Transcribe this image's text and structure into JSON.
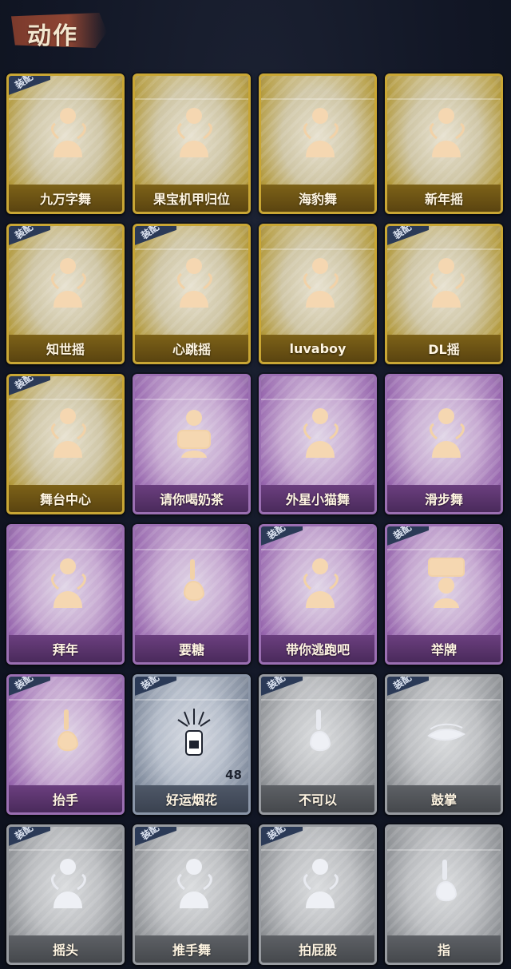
{
  "header": {
    "title": "动作"
  },
  "badges": {
    "equip": "装配"
  },
  "cards": [
    {
      "label": "九万字舞",
      "tier": "gold",
      "equipped": true,
      "icon": "dance-icon"
    },
    {
      "label": "果宝机甲归位",
      "tier": "gold",
      "equipped": false,
      "icon": "dance-icon"
    },
    {
      "label": "海豹舞",
      "tier": "gold",
      "equipped": false,
      "icon": "dance-icon"
    },
    {
      "label": "新年摇",
      "tier": "gold",
      "equipped": false,
      "icon": "dance-icon"
    },
    {
      "label": "知世摇",
      "tier": "gold",
      "equipped": true,
      "icon": "dance-icon"
    },
    {
      "label": "心跳摇",
      "tier": "gold",
      "equipped": true,
      "icon": "dance-icon"
    },
    {
      "label": "luvaboy",
      "tier": "gold",
      "equipped": false,
      "icon": "dance-icon"
    },
    {
      "label": "DL摇",
      "tier": "gold",
      "equipped": true,
      "icon": "dance-icon"
    },
    {
      "label": "舞台中心",
      "tier": "gold",
      "equipped": true,
      "icon": "dance-icon"
    },
    {
      "label": "请你喝奶茶",
      "tier": "purple",
      "equipped": false,
      "icon": "tea-icon"
    },
    {
      "label": "外星小猫舞",
      "tier": "purple",
      "equipped": false,
      "icon": "dance-icon"
    },
    {
      "label": "滑步舞",
      "tier": "purple",
      "equipped": false,
      "icon": "dance-icon"
    },
    {
      "label": "拜年",
      "tier": "purple",
      "equipped": false,
      "icon": "greeting-icon"
    },
    {
      "label": "要糖",
      "tier": "purple",
      "equipped": false,
      "icon": "hand-icon"
    },
    {
      "label": "带你逃跑吧",
      "tier": "purple",
      "equipped": true,
      "icon": "dance-icon"
    },
    {
      "label": "举牌",
      "tier": "purple",
      "equipped": true,
      "icon": "sign-icon"
    },
    {
      "label": "抬手",
      "tier": "purple",
      "equipped": true,
      "icon": "hand-icon"
    },
    {
      "label": "好运烟花",
      "tier": "blue",
      "equipped": true,
      "icon": "firework-icon",
      "count": "48"
    },
    {
      "label": "不可以",
      "tier": "grey",
      "equipped": true,
      "icon": "hand-icon"
    },
    {
      "label": "鼓掌",
      "tier": "grey",
      "equipped": true,
      "icon": "clap-icon"
    },
    {
      "label": "摇头",
      "tier": "grey",
      "equipped": true,
      "icon": "dance-icon"
    },
    {
      "label": "推手舞",
      "tier": "grey",
      "equipped": true,
      "icon": "dance-icon"
    },
    {
      "label": "拍屁股",
      "tier": "grey",
      "equipped": true,
      "icon": "dance-icon"
    },
    {
      "label": "指",
      "tier": "grey",
      "equipped": false,
      "icon": "point-icon"
    }
  ]
}
